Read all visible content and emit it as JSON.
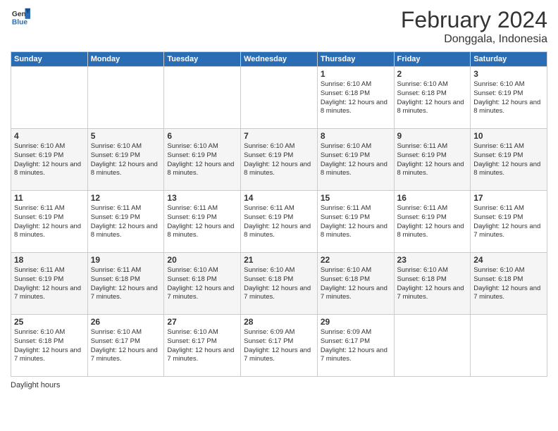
{
  "header": {
    "logo": {
      "general": "General",
      "blue": "Blue"
    },
    "title": "February 2024",
    "location": "Donggala, Indonesia"
  },
  "weekdays": [
    "Sunday",
    "Monday",
    "Tuesday",
    "Wednesday",
    "Thursday",
    "Friday",
    "Saturday"
  ],
  "weeks": [
    [
      null,
      null,
      null,
      null,
      {
        "day": 1,
        "sunrise": "6:10 AM",
        "sunset": "6:18 PM",
        "daylight": "12 hours and 8 minutes."
      },
      {
        "day": 2,
        "sunrise": "6:10 AM",
        "sunset": "6:18 PM",
        "daylight": "12 hours and 8 minutes."
      },
      {
        "day": 3,
        "sunrise": "6:10 AM",
        "sunset": "6:19 PM",
        "daylight": "12 hours and 8 minutes."
      }
    ],
    [
      {
        "day": 4,
        "sunrise": "6:10 AM",
        "sunset": "6:19 PM",
        "daylight": "12 hours and 8 minutes."
      },
      {
        "day": 5,
        "sunrise": "6:10 AM",
        "sunset": "6:19 PM",
        "daylight": "12 hours and 8 minutes."
      },
      {
        "day": 6,
        "sunrise": "6:10 AM",
        "sunset": "6:19 PM",
        "daylight": "12 hours and 8 minutes."
      },
      {
        "day": 7,
        "sunrise": "6:10 AM",
        "sunset": "6:19 PM",
        "daylight": "12 hours and 8 minutes."
      },
      {
        "day": 8,
        "sunrise": "6:10 AM",
        "sunset": "6:19 PM",
        "daylight": "12 hours and 8 minutes."
      },
      {
        "day": 9,
        "sunrise": "6:11 AM",
        "sunset": "6:19 PM",
        "daylight": "12 hours and 8 minutes."
      },
      {
        "day": 10,
        "sunrise": "6:11 AM",
        "sunset": "6:19 PM",
        "daylight": "12 hours and 8 minutes."
      }
    ],
    [
      {
        "day": 11,
        "sunrise": "6:11 AM",
        "sunset": "6:19 PM",
        "daylight": "12 hours and 8 minutes."
      },
      {
        "day": 12,
        "sunrise": "6:11 AM",
        "sunset": "6:19 PM",
        "daylight": "12 hours and 8 minutes."
      },
      {
        "day": 13,
        "sunrise": "6:11 AM",
        "sunset": "6:19 PM",
        "daylight": "12 hours and 8 minutes."
      },
      {
        "day": 14,
        "sunrise": "6:11 AM",
        "sunset": "6:19 PM",
        "daylight": "12 hours and 8 minutes."
      },
      {
        "day": 15,
        "sunrise": "6:11 AM",
        "sunset": "6:19 PM",
        "daylight": "12 hours and 8 minutes."
      },
      {
        "day": 16,
        "sunrise": "6:11 AM",
        "sunset": "6:19 PM",
        "daylight": "12 hours and 8 minutes."
      },
      {
        "day": 17,
        "sunrise": "6:11 AM",
        "sunset": "6:19 PM",
        "daylight": "12 hours and 7 minutes."
      }
    ],
    [
      {
        "day": 18,
        "sunrise": "6:11 AM",
        "sunset": "6:19 PM",
        "daylight": "12 hours and 7 minutes."
      },
      {
        "day": 19,
        "sunrise": "6:11 AM",
        "sunset": "6:18 PM",
        "daylight": "12 hours and 7 minutes."
      },
      {
        "day": 20,
        "sunrise": "6:10 AM",
        "sunset": "6:18 PM",
        "daylight": "12 hours and 7 minutes."
      },
      {
        "day": 21,
        "sunrise": "6:10 AM",
        "sunset": "6:18 PM",
        "daylight": "12 hours and 7 minutes."
      },
      {
        "day": 22,
        "sunrise": "6:10 AM",
        "sunset": "6:18 PM",
        "daylight": "12 hours and 7 minutes."
      },
      {
        "day": 23,
        "sunrise": "6:10 AM",
        "sunset": "6:18 PM",
        "daylight": "12 hours and 7 minutes."
      },
      {
        "day": 24,
        "sunrise": "6:10 AM",
        "sunset": "6:18 PM",
        "daylight": "12 hours and 7 minutes."
      }
    ],
    [
      {
        "day": 25,
        "sunrise": "6:10 AM",
        "sunset": "6:18 PM",
        "daylight": "12 hours and 7 minutes."
      },
      {
        "day": 26,
        "sunrise": "6:10 AM",
        "sunset": "6:17 PM",
        "daylight": "12 hours and 7 minutes."
      },
      {
        "day": 27,
        "sunrise": "6:10 AM",
        "sunset": "6:17 PM",
        "daylight": "12 hours and 7 minutes."
      },
      {
        "day": 28,
        "sunrise": "6:09 AM",
        "sunset": "6:17 PM",
        "daylight": "12 hours and 7 minutes."
      },
      {
        "day": 29,
        "sunrise": "6:09 AM",
        "sunset": "6:17 PM",
        "daylight": "12 hours and 7 minutes."
      },
      null,
      null
    ]
  ],
  "footer": {
    "daylight_label": "Daylight hours"
  }
}
